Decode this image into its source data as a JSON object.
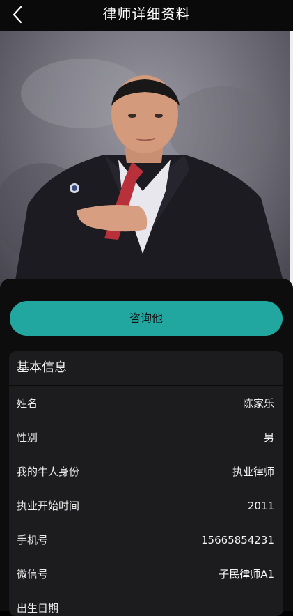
{
  "header": {
    "title": "律师详细资料",
    "back_icon": "chevron-left-icon"
  },
  "actions": {
    "consult_label": "咨询他",
    "accent_color": "#22a6a0"
  },
  "basic_info": {
    "title": "基本信息",
    "rows": [
      {
        "label": "姓名",
        "value": "陈家乐"
      },
      {
        "label": "性别",
        "value": "男"
      },
      {
        "label": "我的牛人身份",
        "value": "执业律师"
      },
      {
        "label": "执业开始时间",
        "value": "2011"
      },
      {
        "label": "手机号",
        "value": "15665854231"
      },
      {
        "label": "微信号",
        "value": "子民律师A1"
      },
      {
        "label": "出生日期",
        "value": ""
      }
    ]
  }
}
